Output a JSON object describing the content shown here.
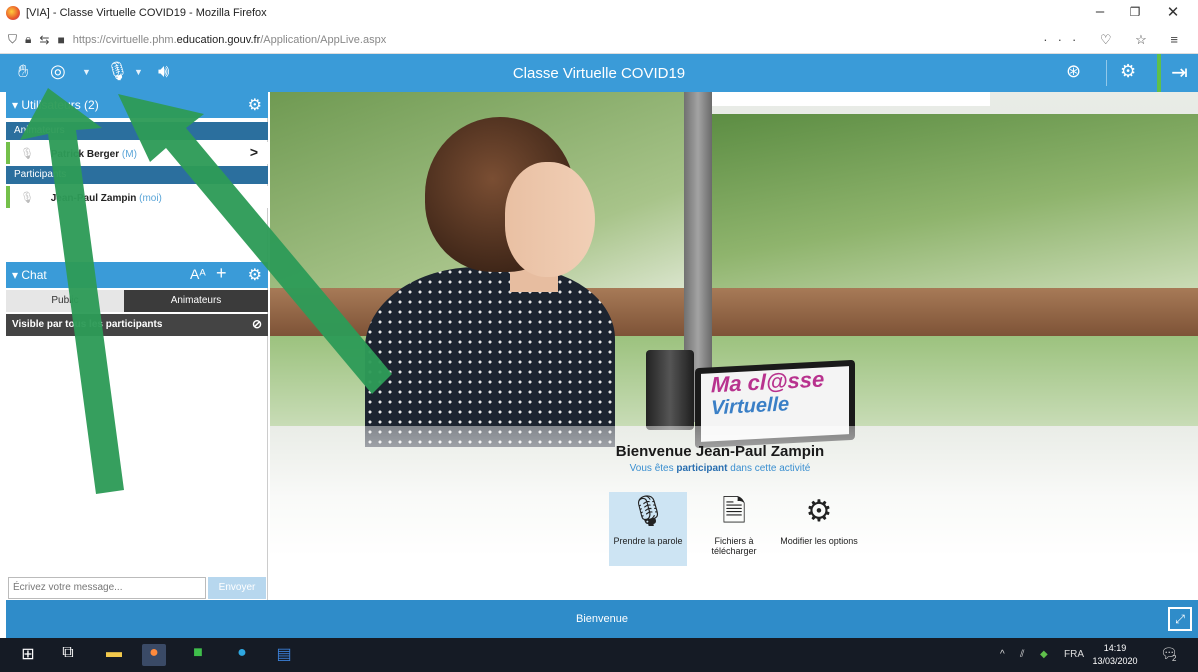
{
  "window": {
    "title": "[VIA] - Classe Virtuelle COVID19 - Mozilla Firefox",
    "minimize": "–",
    "restore": "❐",
    "close": "✕"
  },
  "browser": {
    "url_prefix": "https://cvirtuelle.phm.",
    "url_domain": "education.gouv.fr",
    "url_path": "/Application/AppLive.aspx",
    "right_icons": "··· ♡ ☆ ≡"
  },
  "app": {
    "title": "Classe Virtuelle COVID19",
    "accent": "#3a9bd8",
    "toolbar": {
      "hand_icon": "hand-icon",
      "webcam_icon": "webcam-icon",
      "mic_icon": "microphone-icon",
      "speaker_icon": "speaker-icon"
    }
  },
  "users_panel": {
    "header": "▾ Utilisateurs (2)",
    "animators_label": "Animateurs",
    "animator": {
      "name": "Patrick Berger",
      "tag": "(M)"
    },
    "participants_label": "Participants",
    "participant": {
      "name": "Jean-Paul Zampin",
      "tag": "(moi)"
    }
  },
  "chat": {
    "header": "▾ Chat",
    "font_ctl": "Aᴬ",
    "add_ctl": "+",
    "tabs": [
      "Public",
      "Animateurs"
    ],
    "visible_label": "Visible par tous les participants",
    "placeholder": "Écrivez votre message...",
    "send": "Envoyer"
  },
  "main": {
    "welcome": "Bienvenue Jean-Paul Zampin",
    "subtitle_pre": "Vous êtes ",
    "subtitle_role": "participant",
    "subtitle_post": " dans cette activité",
    "laptop_l1": "Ma cl@sse",
    "laptop_l2": "Virtuelle",
    "actions": [
      {
        "label": "Prendre la parole",
        "icon": "microphone-icon"
      },
      {
        "label": "Fichiers à télécharger",
        "icon": "download-file-icon"
      },
      {
        "label": "Modifier les options",
        "icon": "gear-icon"
      }
    ]
  },
  "footer": {
    "label": "Bienvenue"
  },
  "taskbar": {
    "lang": "FRA",
    "time": "14:19",
    "date": "13/03/2020",
    "notif_count": "2"
  }
}
